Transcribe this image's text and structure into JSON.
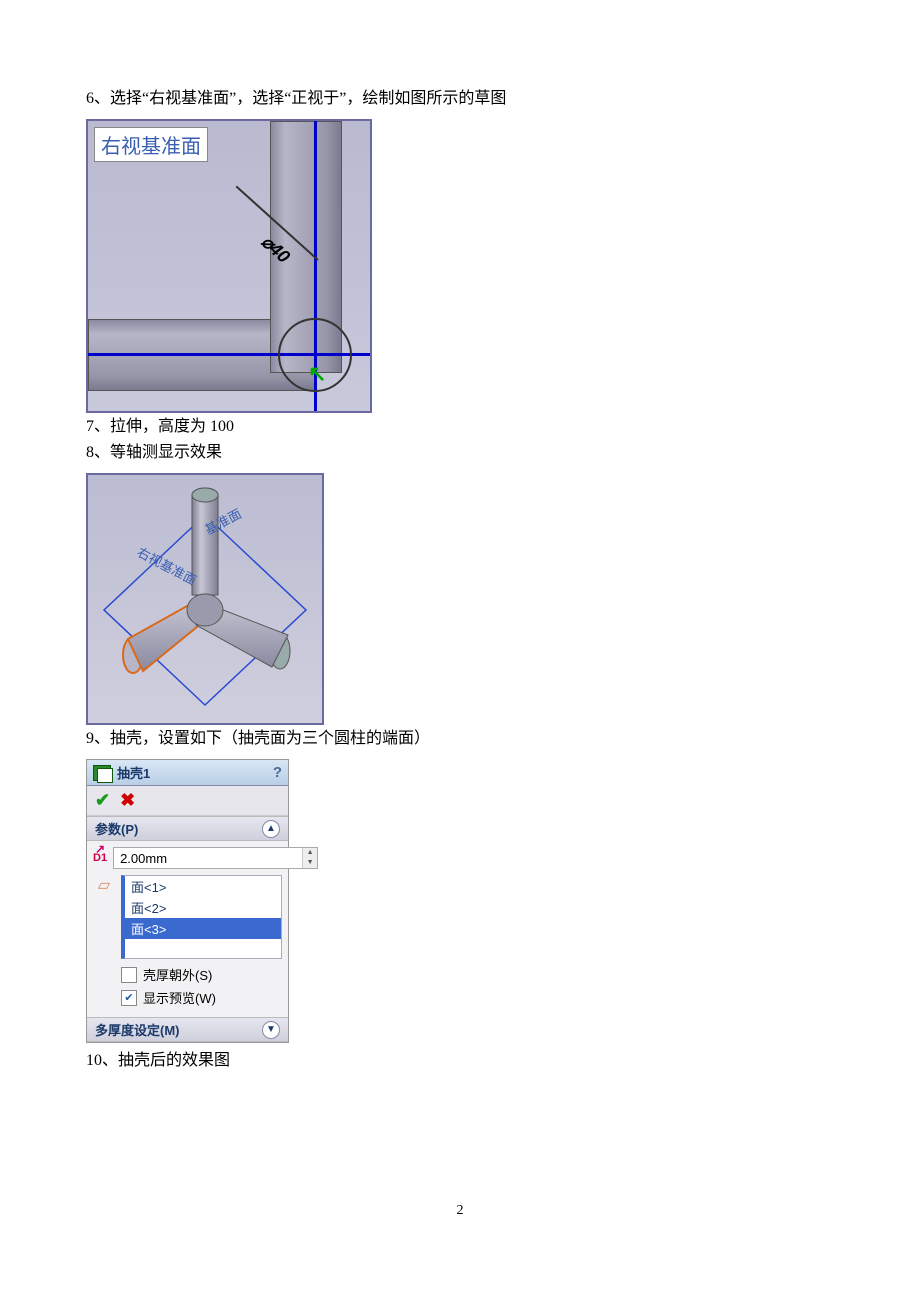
{
  "steps": {
    "s6": "6、选择“右视基准面”，选择“正视于”，绘制如图所示的草图",
    "s7": "7、拉伸，高度为 100",
    "s8": "8、等轴测显示效果",
    "s9": "9、抽壳，设置如下（抽壳面为三个圆柱的端面）",
    "s10": "10、抽壳后的效果图"
  },
  "fig1": {
    "plane_label": "右视基准面",
    "diameter_label": "⌀40"
  },
  "fig2": {
    "plane_label_right": "右视基准面",
    "plane_label_top": "基准面"
  },
  "shell_panel": {
    "title": "抽壳1",
    "help": "?",
    "section_params": "参数(P)",
    "thickness": "2.00mm",
    "faces": [
      "面<1>",
      "面<2>",
      "面<3>"
    ],
    "selected_face_index": 2,
    "cb_outward": "壳厚朝外(S)",
    "cb_outward_checked": false,
    "cb_preview": "显示预览(W)",
    "cb_preview_checked": true,
    "section_multi": "多厚度设定(M)"
  },
  "page_number": "2"
}
